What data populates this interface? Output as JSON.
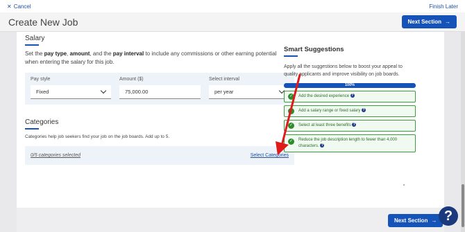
{
  "topbar": {
    "cancel": "Cancel",
    "finish": "Finish Later"
  },
  "header": {
    "title": "Create New Job",
    "next": "Next Section"
  },
  "salary": {
    "title": "Salary",
    "desc_pre": "Set the ",
    "desc_b1": "pay type",
    "desc_m1": ", ",
    "desc_b2": "amount",
    "desc_m2": ", and the ",
    "desc_b3": "pay interval",
    "desc_post": " to include any commissions or other earning potential when entering the salary for this job.",
    "pay_style_label": "Pay style",
    "pay_style_value": "Fixed",
    "amount_label": "Amount ($)",
    "amount_value": "75,000.00",
    "interval_label": "Select interval",
    "interval_value": "per year"
  },
  "categories": {
    "title": "Categories",
    "desc": "Categories help job seekers find your job on the job boards. Add up to 5.",
    "count": "0/5 categories selected",
    "link": "Select Categories"
  },
  "smart": {
    "title": "Smart Suggestions",
    "desc": "Apply all the suggestions below to boost your appeal to quality applicants and improve visibility on job boards.",
    "progress_label": "100%",
    "progress_value": 100,
    "items": [
      "Add the desired experience",
      "Add a salary range or fixed salary",
      "Select at least three benefits",
      "Reduce the job description length to fewer than 4,000 characters."
    ]
  },
  "footer": {
    "next": "Next Section"
  },
  "colors": {
    "primary": "#1653b8",
    "success": "#2e8b2e",
    "annotation": "#e0191b"
  }
}
